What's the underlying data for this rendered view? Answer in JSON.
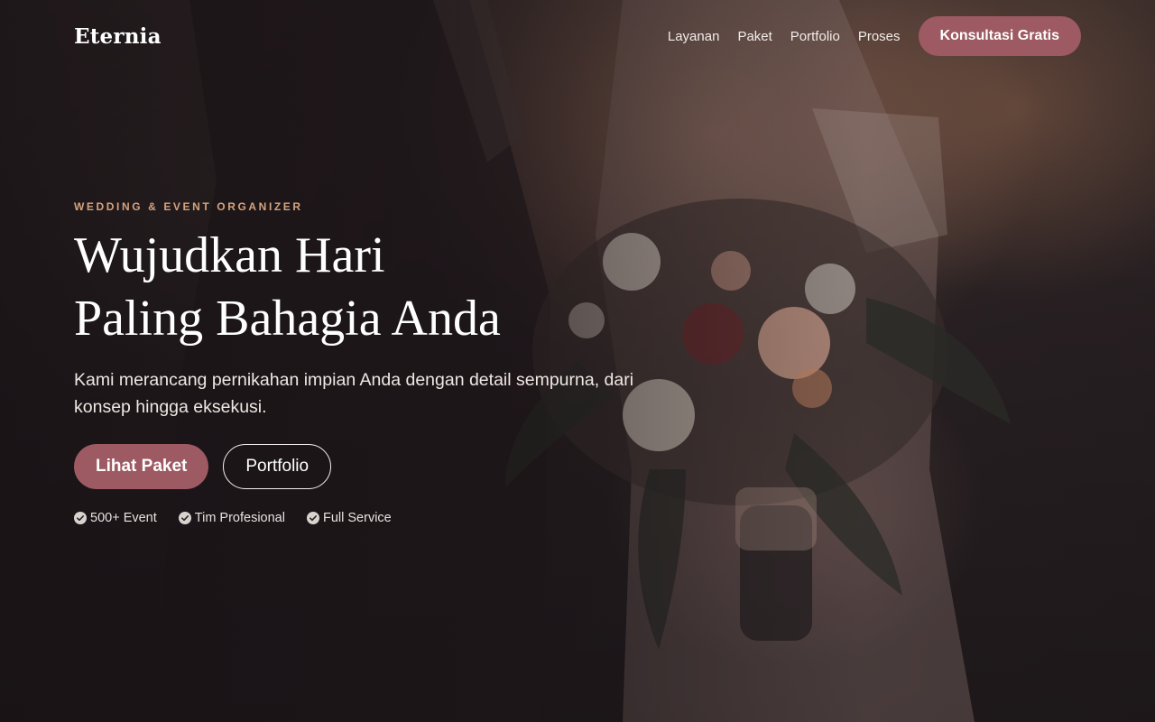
{
  "brand": {
    "logo": "Eternia"
  },
  "nav": {
    "items": [
      {
        "label": "Layanan"
      },
      {
        "label": "Paket"
      },
      {
        "label": "Portfolio"
      },
      {
        "label": "Proses"
      }
    ],
    "cta": "Konsultasi Gratis"
  },
  "hero": {
    "eyebrow": "WEDDING & EVENT ORGANIZER",
    "headline_line1": "Wujudkan Hari",
    "headline_line2": "Paling Bahagia Anda",
    "subtitle": "Kami merancang pernikahan impian Anda dengan detail sempurna, dari konsep hingga eksekusi.",
    "primary_button": "Lihat Paket",
    "secondary_button": "Portfolio",
    "features": [
      {
        "icon": "check-circle-icon",
        "label": "500+ Event"
      },
      {
        "icon": "check-circle-icon",
        "label": "Tim Profesional"
      },
      {
        "icon": "check-circle-icon",
        "label": "Full Service"
      }
    ]
  },
  "colors": {
    "accent": "#9d5a62",
    "eyebrow": "#d4a37e",
    "background": "#1a1416"
  },
  "background_image": {
    "icon": "wedding-bouquet-photo"
  }
}
